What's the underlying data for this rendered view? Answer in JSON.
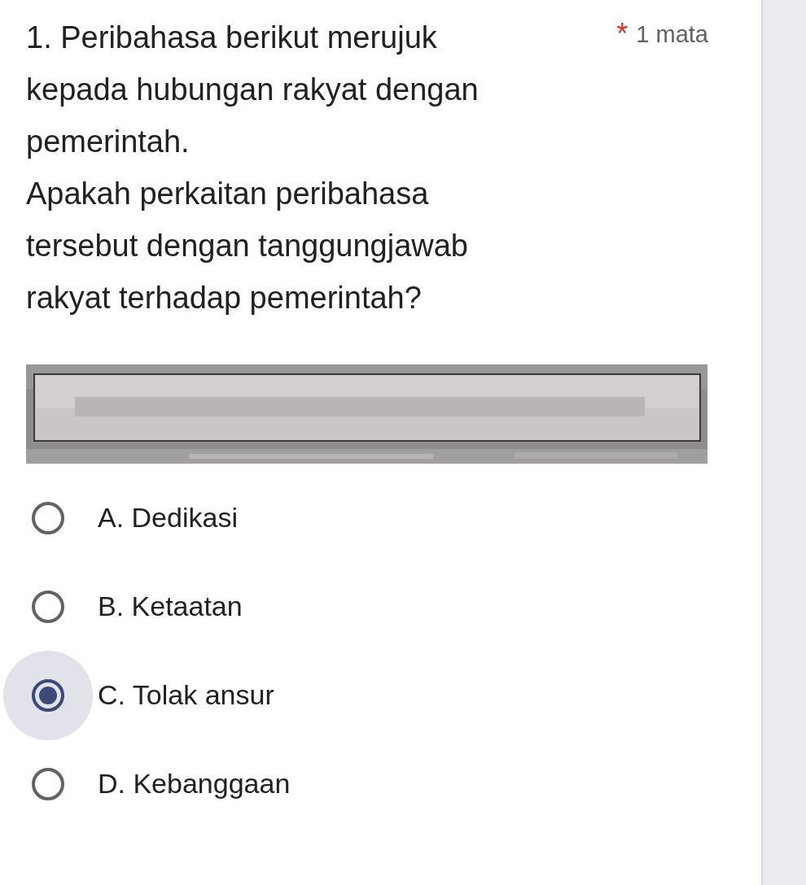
{
  "question": {
    "number": "1.",
    "paragraphs": [
      "Peribahasa berikut merujuk kepada hubungan rakyat dengan pemerintah.",
      "Apakah perkaitan peribahasa tersebut dengan tanggungjawab rakyat terhadap pemerintah?"
    ],
    "required": true,
    "required_mark": "*",
    "points": "1 mata"
  },
  "options": [
    {
      "label": "A. Dedikasi",
      "selected": false
    },
    {
      "label": "B. Ketaatan",
      "selected": false
    },
    {
      "label": "C. Tolak ansur",
      "selected": true
    },
    {
      "label": "D. Kebanggaan",
      "selected": false
    }
  ]
}
